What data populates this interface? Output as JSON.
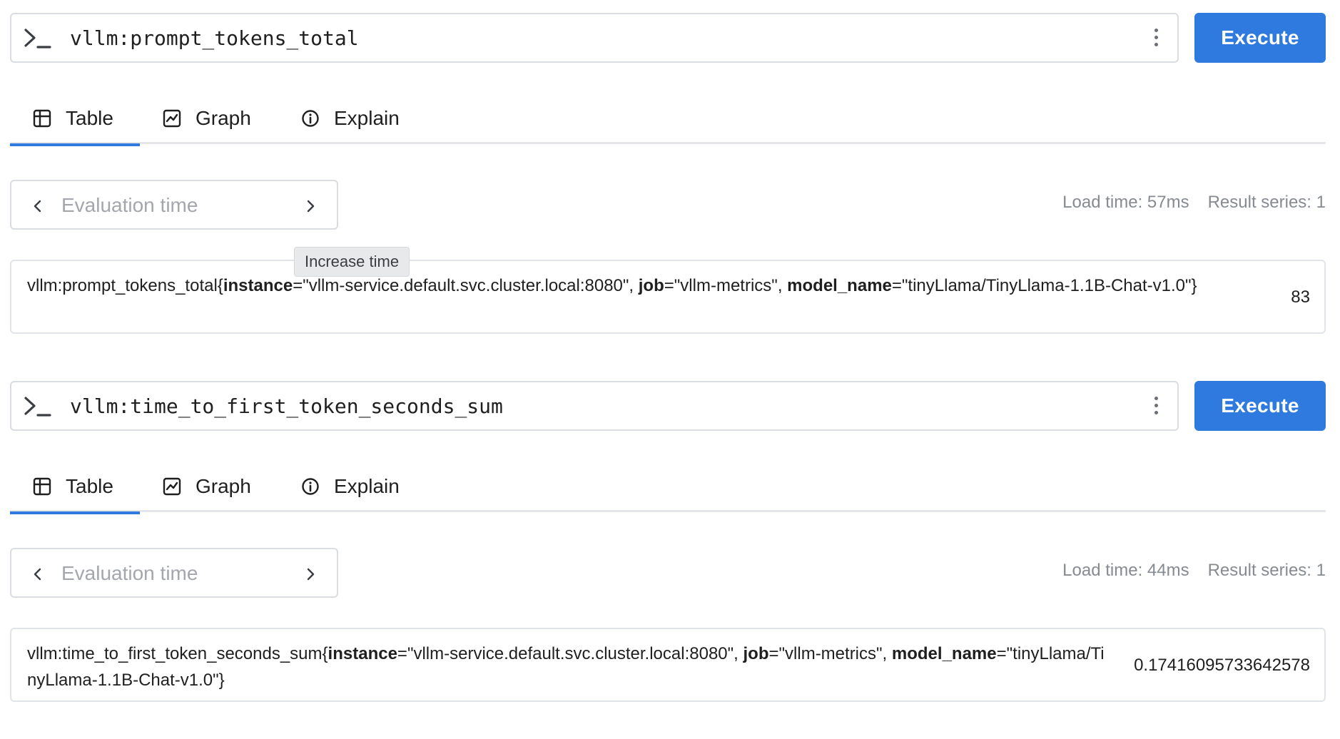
{
  "panels": [
    {
      "expression": "vllm:prompt_tokens_total",
      "execute_label": "Execute",
      "tabs": [
        {
          "label": "Table",
          "active": true
        },
        {
          "label": "Graph",
          "active": false
        },
        {
          "label": "Explain",
          "active": false
        }
      ],
      "eval_placeholder": "Evaluation time",
      "load_time": "Load time: 57ms",
      "result_series": "Result series: 1",
      "tooltip": "Increase time",
      "result": {
        "metric": "vllm:prompt_tokens_total",
        "open_brace": "{",
        "labels": [
          {
            "name": "instance",
            "value": "\"vllm-service.default.svc.cluster.local:8080\""
          },
          {
            "name": "job",
            "value": "\"vllm-metrics\""
          },
          {
            "name": "model_name",
            "value": "\"tinyLlama/TinyLlama-1.1B-Chat-v1.0\""
          }
        ],
        "close_brace": "}",
        "value": "83"
      }
    },
    {
      "expression": "vllm:time_to_first_token_seconds_sum",
      "execute_label": "Execute",
      "tabs": [
        {
          "label": "Table",
          "active": true
        },
        {
          "label": "Graph",
          "active": false
        },
        {
          "label": "Explain",
          "active": false
        }
      ],
      "eval_placeholder": "Evaluation time",
      "load_time": "Load time: 44ms",
      "result_series": "Result series: 1",
      "result": {
        "metric": "vllm:time_to_first_token_seconds_sum",
        "open_brace": "{",
        "labels": [
          {
            "name": "instance",
            "value": "\"vllm-service.default.svc.cluster.local:8080\""
          },
          {
            "name": "job",
            "value": "\"vllm-metrics\""
          },
          {
            "name": "model_name",
            "value": "\"tinyLlama/TinyLlama-1.1B-Chat-v1.0\""
          }
        ],
        "close_brace": "}",
        "value": "0.17416095733642578"
      }
    }
  ],
  "colors": {
    "accent": "#2f7adf",
    "border": "#d9dce1",
    "muted_text": "#868a91",
    "placeholder": "#a3a7ad"
  },
  "icons": {
    "prompt": "terminal-prompt-icon",
    "more": "kebab-menu-icon",
    "table": "table-icon",
    "graph": "graph-icon",
    "explain": "info-icon",
    "prev": "chevron-left-icon",
    "next": "chevron-right-icon"
  }
}
